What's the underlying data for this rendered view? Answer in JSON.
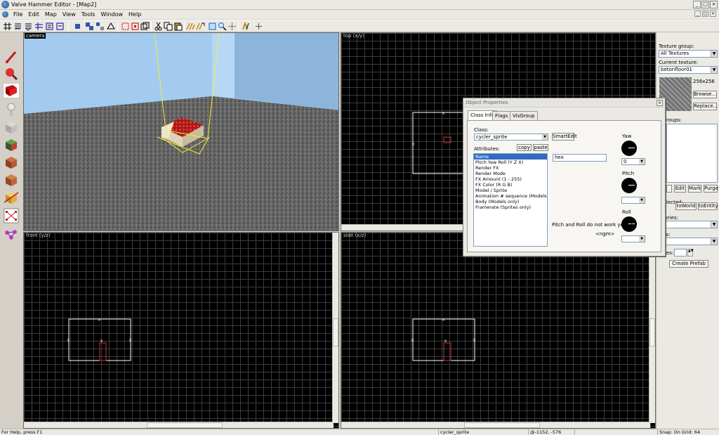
{
  "window": {
    "title": "Valve Hammer Editor - [Map2]"
  },
  "menu": {
    "items": [
      "File",
      "Edit",
      "Map",
      "View",
      "Tools",
      "Window",
      "Help"
    ]
  },
  "viewports": {
    "camera_label": "camera",
    "top_label": "top (x/y)",
    "front_label": "front (y/z)",
    "side_label": "side (x/z)"
  },
  "texture_panel": {
    "group_label": "Texture group:",
    "group_value": "All Textures",
    "current_label": "Current texture:",
    "current_value": "betonfloor01",
    "size": "256x256",
    "browse_label": "Browse...",
    "replace_label": "Replace..."
  },
  "visgroups_panel": {
    "groups_label": "roups:",
    "edit_label": "Edit",
    "mark_label": "Mark",
    "purge_label": "Purge",
    "to_world_label": "toWorld",
    "to_entity_label": "toEntity",
    "selected_label": "lected:",
    "categories_label": "gories:",
    "objects_label": "cts:",
    "faces_label": "es:",
    "create_prefab_label": "Create Prefab"
  },
  "object_properties": {
    "title": "Object Properties",
    "tabs": [
      "Class Info",
      "Flags",
      "VisGroup"
    ],
    "class_label": "Class:",
    "class_value": "cycler_sprite",
    "smartedit_label": "SmartEdit",
    "attributes_label": "Attributes:",
    "copy_label": "copy",
    "paste_label": "paste",
    "attributes": [
      "Name",
      "Pitch Yaw Roll (Y Z X)",
      "Render FX",
      "Render Mode",
      "FX Amount (1 - 255)",
      "FX Color (R G B)",
      "Model / Sprite",
      "Animation # sequence (Models only)",
      "Body (Models only)",
      "Framerate (Sprites only)"
    ],
    "selected_attribute_index": 0,
    "name_value": "hex",
    "yaw_label": "Yaw",
    "yaw_value": "0",
    "pitch_label": "Pitch",
    "roll_label": "Roll",
    "note": "Pitch and Roll do not work yet. ->",
    "note2": "<ngm>"
  },
  "statusbar": {
    "help": "For Help, press F1",
    "selection": "cycler_sprite",
    "coords": "@-1152, -576",
    "snap": "Snap: On Grid: 64"
  },
  "colors": {
    "chrome": "#ebe9e3",
    "viewport_bg": "#000000",
    "grid": "#3c3c3c",
    "selection_yellow": "#ffff33",
    "brush_white": "#ffffff",
    "entity_red": "#c83232",
    "list_highlight": "#316ac5"
  }
}
